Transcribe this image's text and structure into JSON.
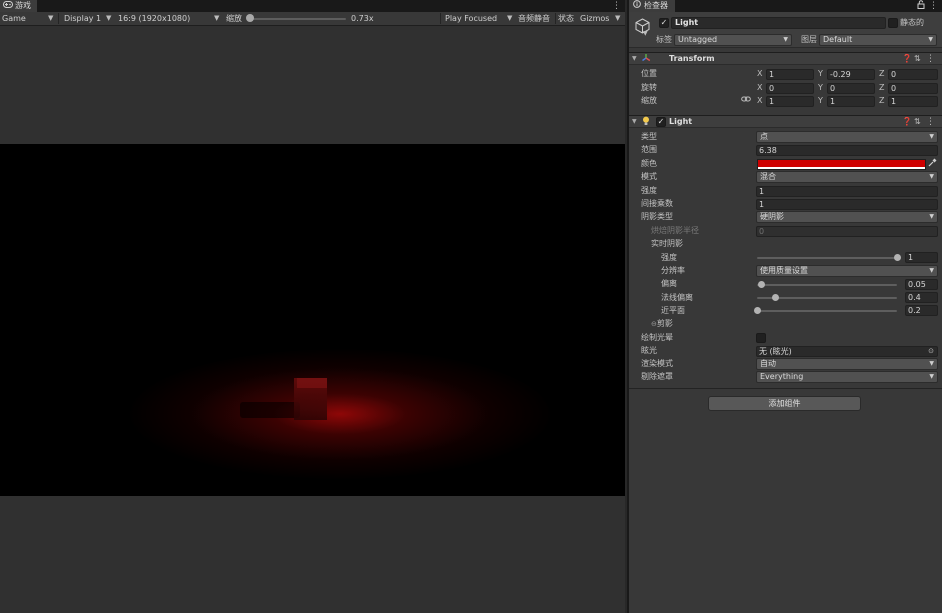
{
  "game": {
    "tab_label": "游戏",
    "toolbar": {
      "mode": "Game",
      "display": "Display 1",
      "aspect": "16:9 (1920x1080)",
      "scale_label": "缩放",
      "scale_value": "0.73x",
      "play_mode": "Play Focused",
      "mute_label": "音频静音",
      "stats_label": "状态",
      "gizmos_label": "Gizmos"
    },
    "scene": {
      "background_color": "#000000",
      "light_color": "#cf0000"
    }
  },
  "inspector": {
    "tab_label": "检查器",
    "object": {
      "active": true,
      "name": "Light",
      "static_label": "静态的",
      "tag_label": "标签",
      "tag_value": "Untagged",
      "layer_label": "图层",
      "layer_value": "Default"
    },
    "transform": {
      "title": "Transform",
      "position_label": "位置",
      "rotation_label": "旋转",
      "scale_label": "缩放",
      "axis_x": "X",
      "axis_y": "Y",
      "axis_z": "Z",
      "position": [
        "1",
        "-0.29",
        "0"
      ],
      "rotation": [
        "0",
        "0",
        "0"
      ],
      "scale": [
        "1",
        "1",
        "1"
      ]
    },
    "light": {
      "title": "Light",
      "enabled": true,
      "type_label": "类型",
      "type_value": "点",
      "range_label": "范围",
      "range_value": "6.38",
      "color_label": "颜色",
      "color_value": "#cf0000",
      "mode_label": "模式",
      "mode_value": "混合",
      "intensity_label": "强度",
      "intensity_value": "1",
      "indirect_label": "间接乘数",
      "indirect_value": "1",
      "shadow_type_label": "阴影类型",
      "shadow_type_value": "硬阴影",
      "baked_radius_label": "烘焙阴影半径",
      "baked_radius_value": "0",
      "realtime_shadows_label": "实时阴影",
      "strength_label": "强度",
      "strength_value": "1",
      "strength_fraction": 1.0,
      "resolution_label": "分辨率",
      "resolution_value": "使用质量设置",
      "bias_label": "偏离",
      "bias_value": "0.05",
      "bias_fraction": 0.025,
      "normal_bias_label": "法线偏离",
      "normal_bias_value": "0.4",
      "normal_bias_fraction": 0.13,
      "near_plane_label": "近平面",
      "near_plane_value": "0.2",
      "near_plane_fraction": 0.0,
      "cookie_label": "剪影",
      "draw_halo_label": "绘制光晕",
      "draw_halo_checked": false,
      "flare_label": "眩光",
      "flare_value": "无 (眩光)",
      "render_mode_label": "渲染模式",
      "render_mode_value": "自动",
      "culling_mask_label": "剔除遮罩",
      "culling_mask_value": "Everything"
    },
    "add_component_label": "添加组件"
  }
}
